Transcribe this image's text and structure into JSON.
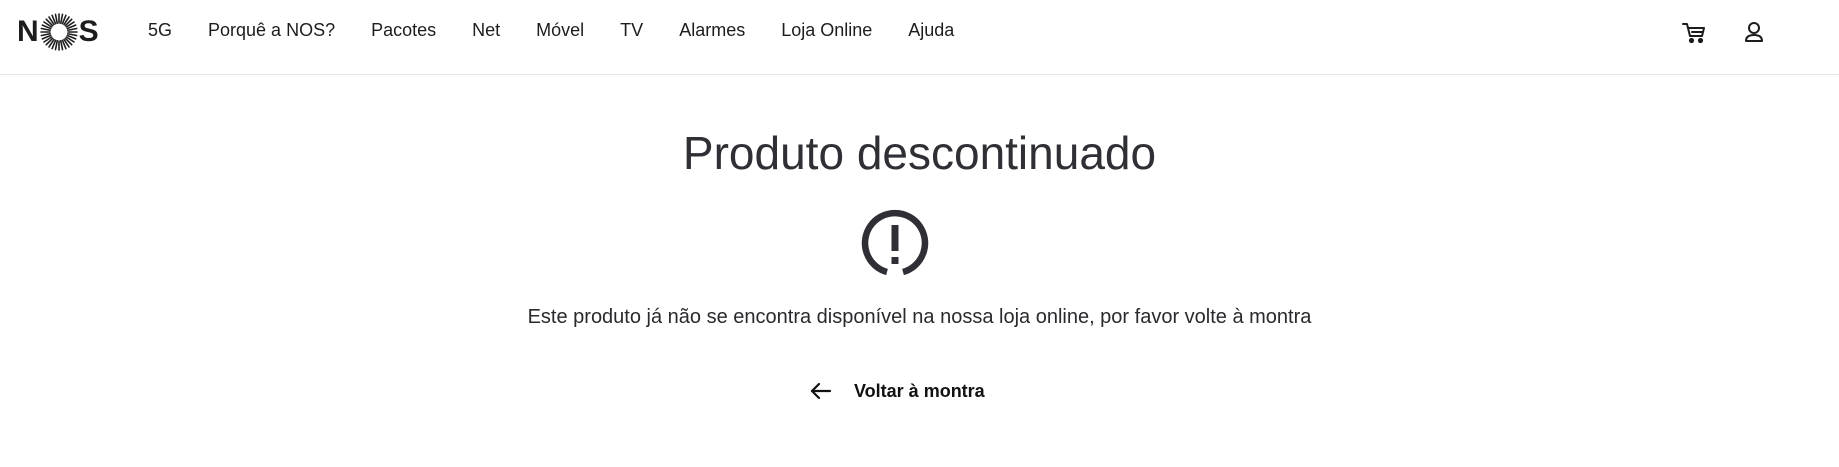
{
  "header": {
    "logo": {
      "letters": [
        "N",
        "S"
      ],
      "icon": "sunburst-o-icon"
    },
    "nav": [
      {
        "label": "5G"
      },
      {
        "label": "Porquê a NOS?"
      },
      {
        "label": "Pacotes"
      },
      {
        "label": "Net"
      },
      {
        "label": "Móvel"
      },
      {
        "label": "TV"
      },
      {
        "label": "Alarmes"
      },
      {
        "label": "Loja Online"
      },
      {
        "label": "Ajuda"
      }
    ],
    "icons": {
      "cart": "cart-icon",
      "user": "user-icon"
    }
  },
  "main": {
    "title": "Produto descontinuado",
    "alert_icon": "exclamation-circle-icon",
    "message": "Este produto já não se encontra disponível na nossa loja online, por favor volte à montra",
    "back_link": {
      "label": "Voltar à montra",
      "icon": "arrow-left-icon"
    }
  },
  "colors": {
    "text": "#2a2a2e",
    "divider": "#e6e6e6",
    "background": "#ffffff"
  }
}
